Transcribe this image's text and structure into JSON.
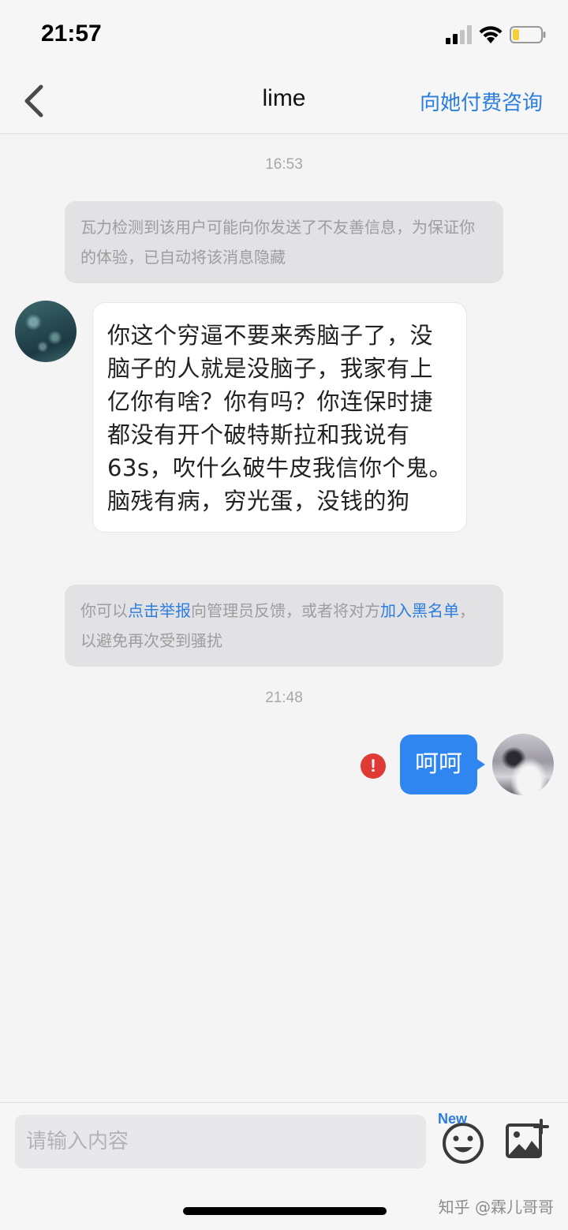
{
  "status_bar": {
    "time": "21:57"
  },
  "nav": {
    "title": "lime",
    "action": "向她付费咨询"
  },
  "chat": {
    "timestamp_1": "16:53",
    "notice_1": "瓦力检测到该用户可能向你发送了不友善信息，为保证你的体验，已自动将该消息隐藏",
    "incoming_message": "你这个穷逼不要来秀脑子了，没脑子的人就是没脑子，我家有上亿你有啥？你有吗？你连保时捷都没有开个破特斯拉和我说有63s，吹什么破牛皮我信你个鬼。脑残有病，穷光蛋，没钱的狗",
    "notice_2": {
      "prefix": "你可以",
      "report_link": "点击举报",
      "middle": "向管理员反馈，或者将对方",
      "blacklist_link": "加入黑名单",
      "suffix": "，以避免再次受到骚扰"
    },
    "timestamp_2": "21:48",
    "outgoing_message": "呵呵",
    "error_mark": "!"
  },
  "input": {
    "placeholder": "请输入内容",
    "new_badge": "New"
  },
  "watermark": "知乎 @霖儿哥哥",
  "colors": {
    "accent": "#2b7de0",
    "outgoing_bubble": "#2f86f0",
    "error": "#e03a35"
  }
}
